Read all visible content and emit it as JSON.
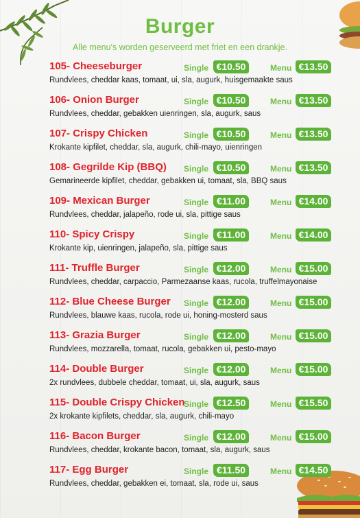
{
  "header": {
    "title": "Burger",
    "subtitle": "Alle menu's worden geserveerd met friet en een drankje."
  },
  "colors": {
    "accent": "#6fbe44",
    "name": "#e0222b",
    "badge": "#5cb338"
  },
  "labels": {
    "single": "Single",
    "menu": "Menu"
  },
  "items": [
    {
      "name": "105- Cheeseburger",
      "single": "€10.50",
      "menu": "€13.50",
      "desc": "Rundvlees, cheddar kaas, tomaat, ui, sla, augurk, huisgemaakte saus"
    },
    {
      "name": "106- Onion Burger",
      "single": "€10.50",
      "menu": "€13.50",
      "desc": "Rundvlees, cheddar, gebakken uienringen, sla, augurk, saus"
    },
    {
      "name": "107- Crispy Chicken",
      "single": "€10.50",
      "menu": "€13.50",
      "desc": "Krokante kipfilet, cheddar, sla, augurk, chili-mayo, uienringen"
    },
    {
      "name": "108- Gegrilde Kip (BBQ)",
      "single": "€10.50",
      "menu": "€13.50",
      "desc": "Gemarineerde kipfilet, cheddar, gebakken ui, tomaat, sla, BBQ saus"
    },
    {
      "name": "109- Mexican Burger",
      "single": "€11.00",
      "menu": "€14.00",
      "desc": "Rundvlees, cheddar, jalapeño, rode ui, sla, pittige saus"
    },
    {
      "name": "110- Spicy Crispy",
      "single": "€11.00",
      "menu": "€14.00",
      "desc": "Krokante kip, uienringen, jalapeño, sla, pittige saus"
    },
    {
      "name": "111- Truffle Burger",
      "single": "€12.00",
      "menu": "€15.00",
      "desc": "Rundvlees, cheddar, carpaccio, Parmezaanse kaas, rucola, truffelmayonaise"
    },
    {
      "name": "112- Blue Cheese Burger",
      "single": "€12.00",
      "menu": "€15.00",
      "desc": "Rundvlees, blauwe kaas, rucola, rode ui, honing-mosterd saus"
    },
    {
      "name": "113- Grazia Burger",
      "single": "€12.00",
      "menu": "€15.00",
      "desc": "Rundvlees, mozzarella, tomaat, rucola, gebakken ui, pesto-mayo"
    },
    {
      "name": "114- Double Burger",
      "single": "€12.00",
      "menu": "€15.00",
      "desc": "2x rundvlees, dubbele cheddar, tomaat, ui, sla, augurk, saus"
    },
    {
      "name": "115- Double Crispy Chicken",
      "single": "€12.50",
      "menu": "€15.50",
      "desc": "2x krokante kipfilets, cheddar, sla, augurk, chili-mayo"
    },
    {
      "name": "116- Bacon Burger",
      "single": "€12.00",
      "menu": "€15.00",
      "desc": "Rundvlees, cheddar, krokante bacon, tomaat, sla, augurk, saus"
    },
    {
      "name": "117- Egg Burger",
      "single": "€11.50",
      "menu": "€14.50",
      "desc": "Rundvlees, cheddar, gebakken ei, tomaat, sla, rode ui, saus"
    }
  ]
}
